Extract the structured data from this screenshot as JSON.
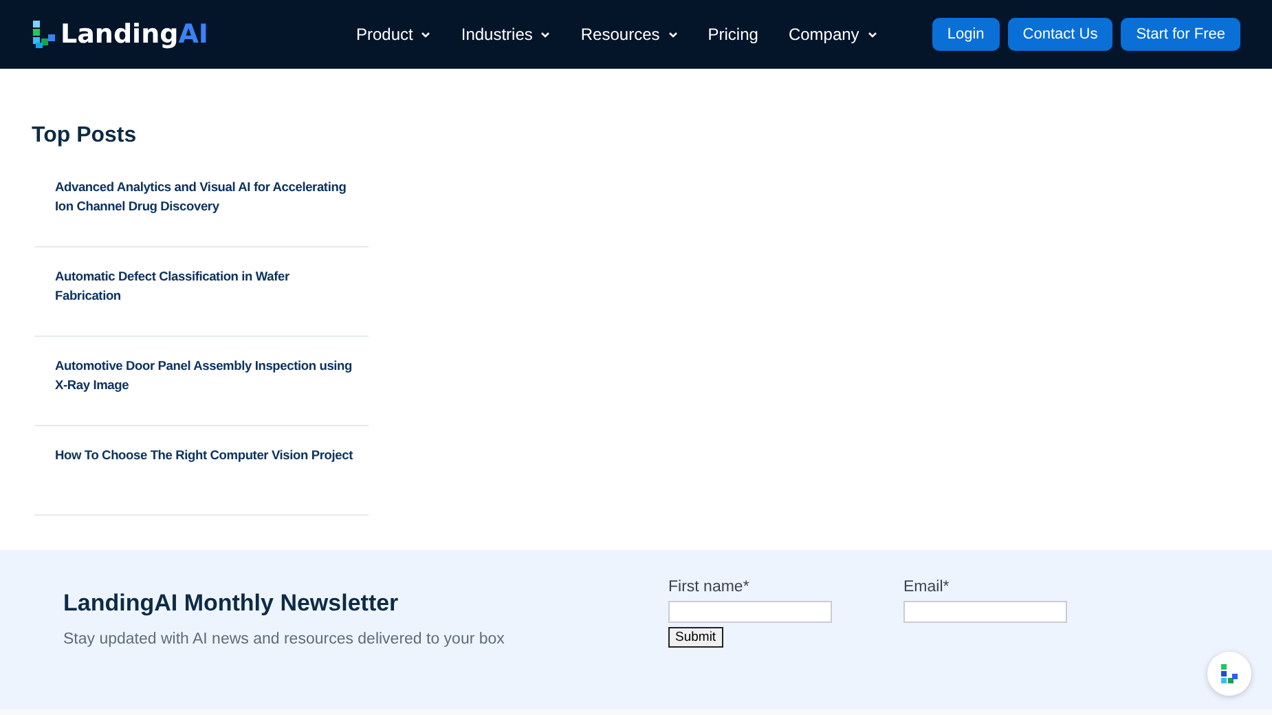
{
  "header": {
    "logo": {
      "text": "Landing",
      "accent": "AI"
    },
    "nav": [
      {
        "label": "Product",
        "dropdown": true
      },
      {
        "label": "Industries",
        "dropdown": true
      },
      {
        "label": "Resources",
        "dropdown": true
      },
      {
        "label": "Pricing",
        "dropdown": false
      },
      {
        "label": "Company",
        "dropdown": true
      }
    ],
    "buttons": [
      "Login",
      "Contact Us",
      "Start for Free"
    ]
  },
  "top_posts": {
    "title": "Top Posts",
    "items": [
      "Advanced Analytics and Visual AI for Accelerating Ion Channel Drug Discovery",
      "Automatic Defect Classification in Wafer Fabrication",
      "Automotive Door Panel Assembly Inspection using X-Ray Image",
      "How To Choose The Right Computer Vision Project"
    ]
  },
  "newsletter": {
    "title": "LandingAI Monthly Newsletter",
    "subtitle": "Stay updated with AI news and resources delivered to your box",
    "fields": [
      {
        "label": "First name*"
      },
      {
        "label": "Email*"
      }
    ],
    "submit": "Submit"
  }
}
